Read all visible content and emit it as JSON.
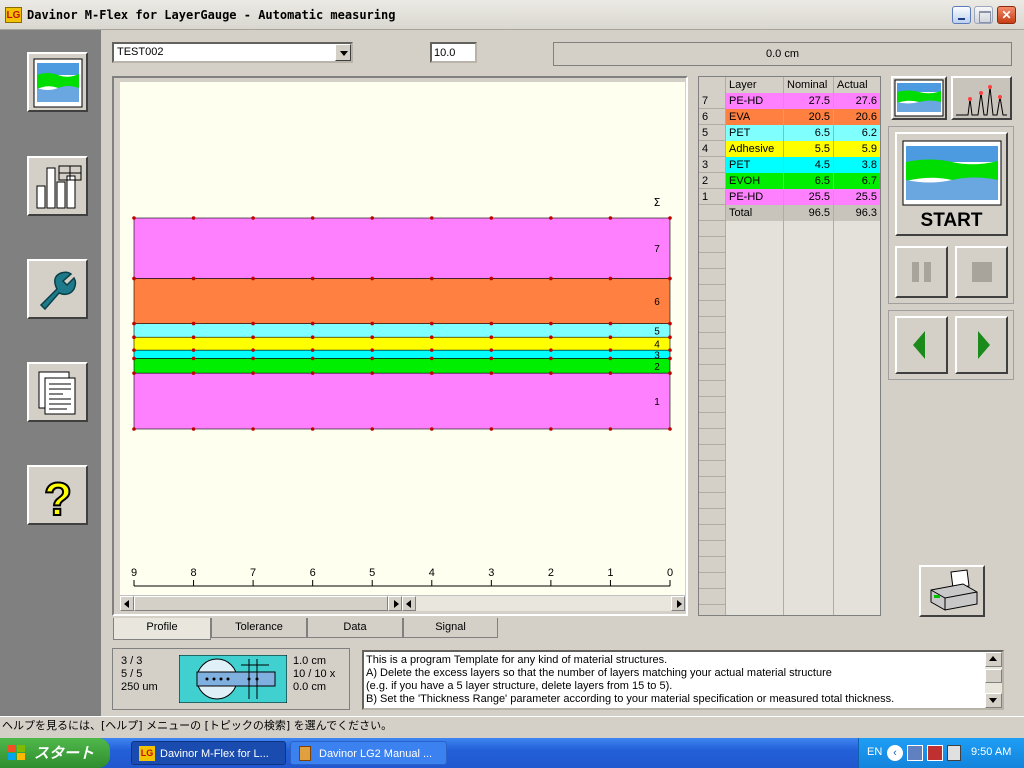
{
  "window": {
    "title": "Davinor M-Flex for LayerGauge - Automatic measuring",
    "logo": "LG"
  },
  "sidebar": {
    "items": [
      {
        "icon": "profile-view-icon"
      },
      {
        "icon": "statistics-icon"
      },
      {
        "icon": "wrench-icon"
      },
      {
        "icon": "report-icon"
      },
      {
        "icon": "help-icon",
        "glyph": "?"
      }
    ]
  },
  "toolbar": {
    "file_select_value": "TEST002",
    "value_input": "10.0",
    "position_readout": "0.0 cm"
  },
  "chart_data": {
    "type": "area",
    "sigma_label": "Σ",
    "x_ticks": [
      "9",
      "8",
      "7",
      "6",
      "5",
      "4",
      "3",
      "2",
      "1",
      "0"
    ],
    "layers": [
      {
        "index": "1",
        "color": "#ff80ff",
        "thickness": 25.5
      },
      {
        "index": "2",
        "color": "#00ee00",
        "thickness": 6.7
      },
      {
        "index": "3",
        "color": "#00ffff",
        "thickness": 3.8
      },
      {
        "index": "4",
        "color": "#ffff00",
        "thickness": 5.9
      },
      {
        "index": "5",
        "color": "#80ffff",
        "thickness": 6.2
      },
      {
        "index": "6",
        "color": "#ff8040",
        "thickness": 20.6
      },
      {
        "index": "7",
        "color": "#ff80ff",
        "thickness": 27.6
      }
    ],
    "total_thickness": 96.3
  },
  "tabs": [
    {
      "label": "Profile",
      "active": true
    },
    {
      "label": "Tolerance",
      "active": false
    },
    {
      "label": "Data",
      "active": false
    },
    {
      "label": "Signal",
      "active": false
    }
  ],
  "layer_table": {
    "headers": [
      "",
      "Layer",
      "Nominal",
      "Actual"
    ],
    "rows": [
      {
        "idx": "7",
        "name": "PE-HD",
        "nominal": "27.5",
        "actual": "27.6",
        "color": "#ff80ff"
      },
      {
        "idx": "6",
        "name": "EVA",
        "nominal": "20.5",
        "actual": "20.6",
        "color": "#ff8040"
      },
      {
        "idx": "5",
        "name": "PET",
        "nominal": "6.5",
        "actual": "6.2",
        "color": "#80ffff"
      },
      {
        "idx": "4",
        "name": "Adhesive",
        "nominal": "5.5",
        "actual": "5.9",
        "color": "#ffff00"
      },
      {
        "idx": "3",
        "name": "PET",
        "nominal": "4.5",
        "actual": "3.8",
        "color": "#00ffff"
      },
      {
        "idx": "2",
        "name": "EVOH",
        "nominal": "6.5",
        "actual": "6.7",
        "color": "#00ee00"
      },
      {
        "idx": "1",
        "name": "PE-HD",
        "nominal": "25.5",
        "actual": "25.5",
        "color": "#ff80ff"
      }
    ],
    "total": {
      "name": "Total",
      "nominal": "96.5",
      "actual": "96.3"
    }
  },
  "controls": {
    "start_label": "START"
  },
  "info_panel": {
    "counts": [
      "3 / 3",
      "5 / 5",
      "250 um"
    ],
    "settings": [
      "1.0 cm",
      "10 / 10 x",
      "0.0 cm"
    ]
  },
  "description": [
    "This is a program Template for any kind of material structures.",
    "A) Delete the excess layers so that the number of layers matching your actual material structure",
    "     (e.g. if you have a 5 layer structure, delete layers from 15 to 5).",
    "B) Set the 'Thickness Range' parameter according to your material specification or measured total thickness."
  ],
  "statusbar": {
    "text": "ヘルプを見るには、[ヘルプ] メニューの [トピックの検索] を選んでください。"
  },
  "taskbar": {
    "start_label": "スタート",
    "tasks": [
      {
        "label": "Davinor M-Flex for L..."
      },
      {
        "label": "Davinor LG2 Manual ..."
      }
    ],
    "lang": "EN",
    "clock": "9:50 AM"
  }
}
